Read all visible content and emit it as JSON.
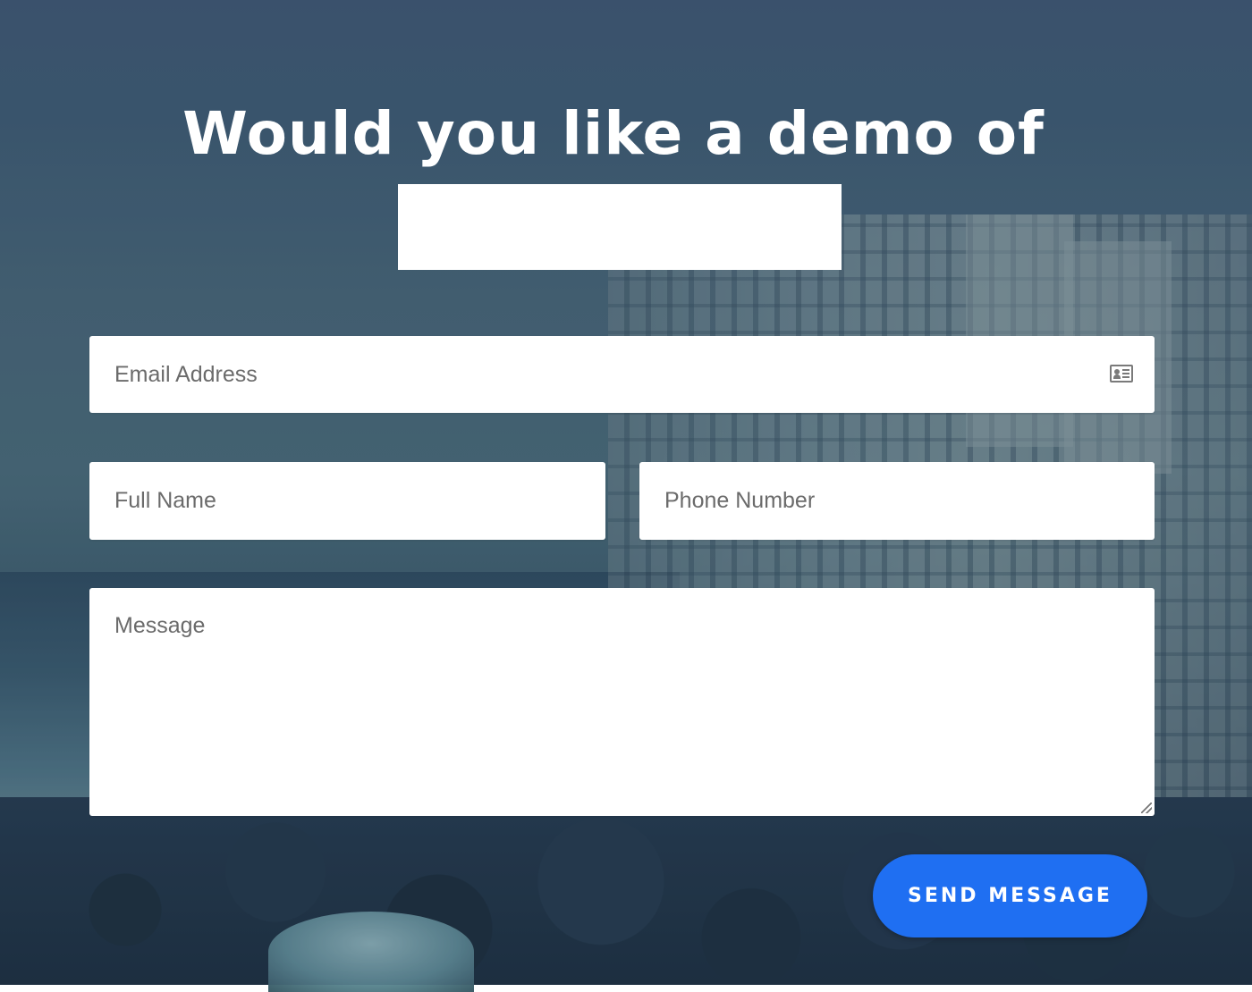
{
  "heading": {
    "text": "Would you like a demo of"
  },
  "form": {
    "email": {
      "placeholder": "Email Address",
      "icon": "contact-card-icon"
    },
    "full_name": {
      "placeholder": "Full Name"
    },
    "phone": {
      "placeholder": "Phone Number"
    },
    "message": {
      "placeholder": "Message"
    },
    "submit_label": "SEND MESSAGE"
  },
  "colors": {
    "button": "#1f6ff2",
    "heading_text": "#ffffff",
    "background_tint": "#3f5670"
  }
}
